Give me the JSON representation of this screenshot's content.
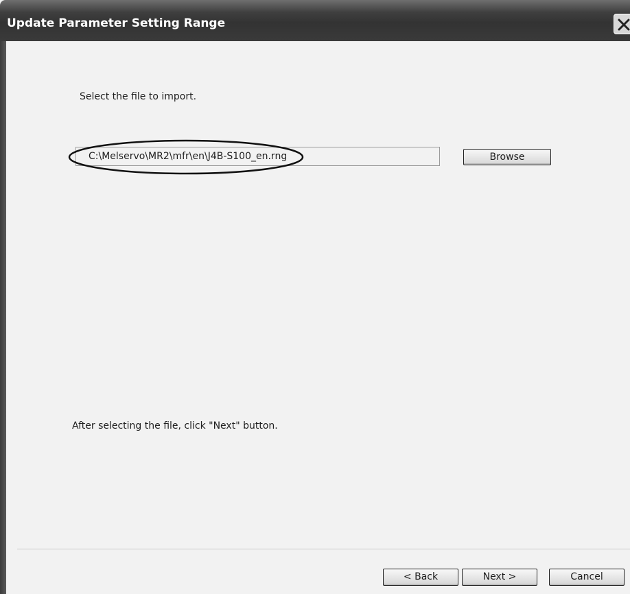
{
  "window": {
    "title": "Update Parameter Setting Range"
  },
  "icons": {
    "close": "close-icon"
  },
  "main": {
    "instruction": "Select the file to import.",
    "file_path": "C:\\Melservo\\MR2\\mfr\\en\\J4B-S100_en.rng",
    "browse_label": "Browse",
    "hint": "After selecting the file, click \"Next\" button."
  },
  "footer": {
    "back_label": "< Back",
    "next_label": "Next >",
    "cancel_label": "Cancel"
  }
}
